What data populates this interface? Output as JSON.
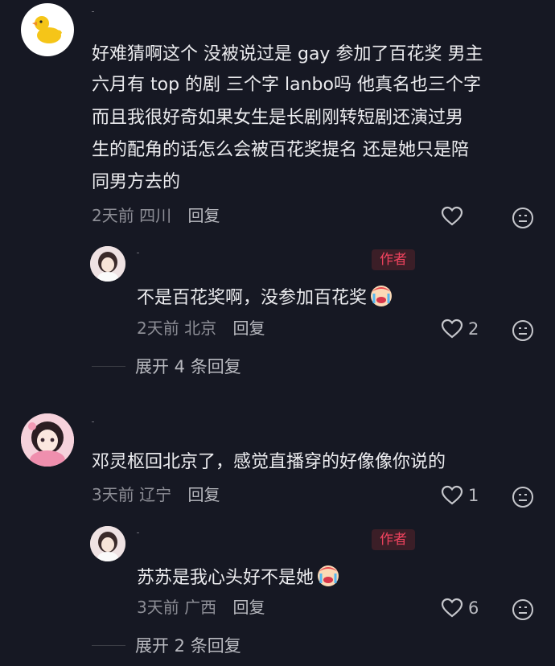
{
  "comments": [
    {
      "avatar": "duck-icon",
      "lines": [
        "好难猜啊这个 没被说过是 gay 参加了百花奖 男主",
        "六月有 top 的剧 三个字 lanbo吗 他真名也三个字",
        "而且我很好奇如果女生是长剧刚转短剧还演过男",
        "生的配角的话怎么会被百花奖提名 还是她只是陪",
        "同男方去的"
      ],
      "time": "2天前",
      "location": "四川",
      "reply_label": "回复",
      "likes": "",
      "reply": {
        "tag": "作者",
        "text": "不是百花奖啊，没参加百花奖",
        "emoji": "crying-face-icon",
        "time": "2天前",
        "location": "北京",
        "reply_label": "回复",
        "likes": "2"
      },
      "expand": "展开 4 条回复"
    },
    {
      "avatar": "anime-girl-icon",
      "lines": [
        "邓灵枢回北京了，感觉直播穿的好像像你说的"
      ],
      "time": "3天前",
      "location": "辽宁",
      "reply_label": "回复",
      "likes": "1",
      "reply": {
        "tag": "作者",
        "text": "苏苏是我心头好不是她",
        "emoji": "crying-face-icon",
        "time": "3天前",
        "location": "广西",
        "reply_label": "回复",
        "likes": "6"
      },
      "expand": "展开 2 条回复"
    }
  ]
}
